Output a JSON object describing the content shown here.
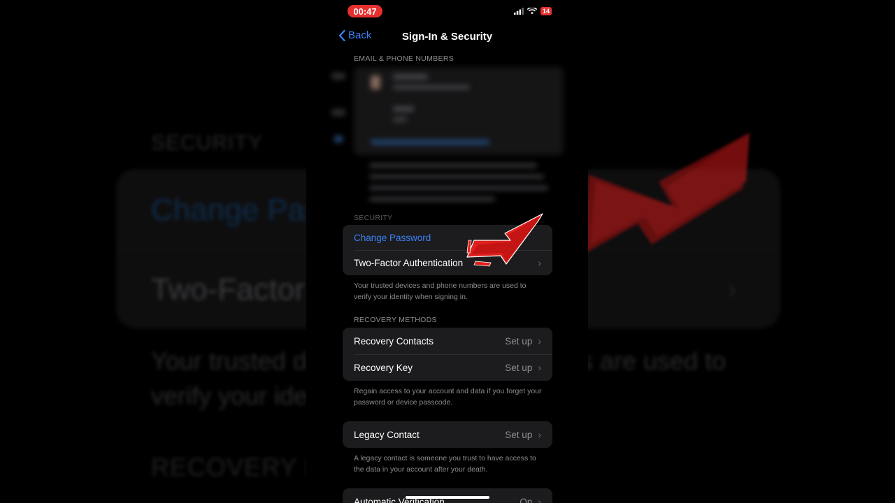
{
  "background": {
    "security_header": "SECURITY",
    "change_password": "Change Pas",
    "two_factor": "Two-Factor",
    "trusted_1": "Your trusted de",
    "trusted_1b": "s are used to",
    "trusted_2": "verify your ide",
    "recovery_header": "RECOVERY ME",
    "chevron": "›"
  },
  "status_bar": {
    "time": "00:47",
    "battery": "14"
  },
  "nav": {
    "back_label": "Back",
    "title": "Sign-In & Security"
  },
  "email_section": {
    "header": "EMAIL & PHONE NUMBERS"
  },
  "security": {
    "header": "SECURITY",
    "change_password": "Change Password",
    "two_factor": "Two-Factor Authentication",
    "footnote": "Your trusted devices and phone numbers are used to verify your identity when signing in."
  },
  "recovery": {
    "header": "RECOVERY METHODS",
    "contacts_label": "Recovery Contacts",
    "contacts_value": "Set up",
    "key_label": "Recovery Key",
    "key_value": "Set up",
    "footnote": "Regain access to your account and data if you forget your password or device passcode."
  },
  "legacy": {
    "label": "Legacy Contact",
    "value": "Set up",
    "footnote": "A legacy contact is someone you trust to have access to the data in your account after your death."
  },
  "automatic": {
    "label": "Automatic Verification",
    "value": "On"
  },
  "colors": {
    "accent_blue": "#3b82f6",
    "arrow_red": "#e0201c",
    "group_bg": "#1c1c1e"
  }
}
